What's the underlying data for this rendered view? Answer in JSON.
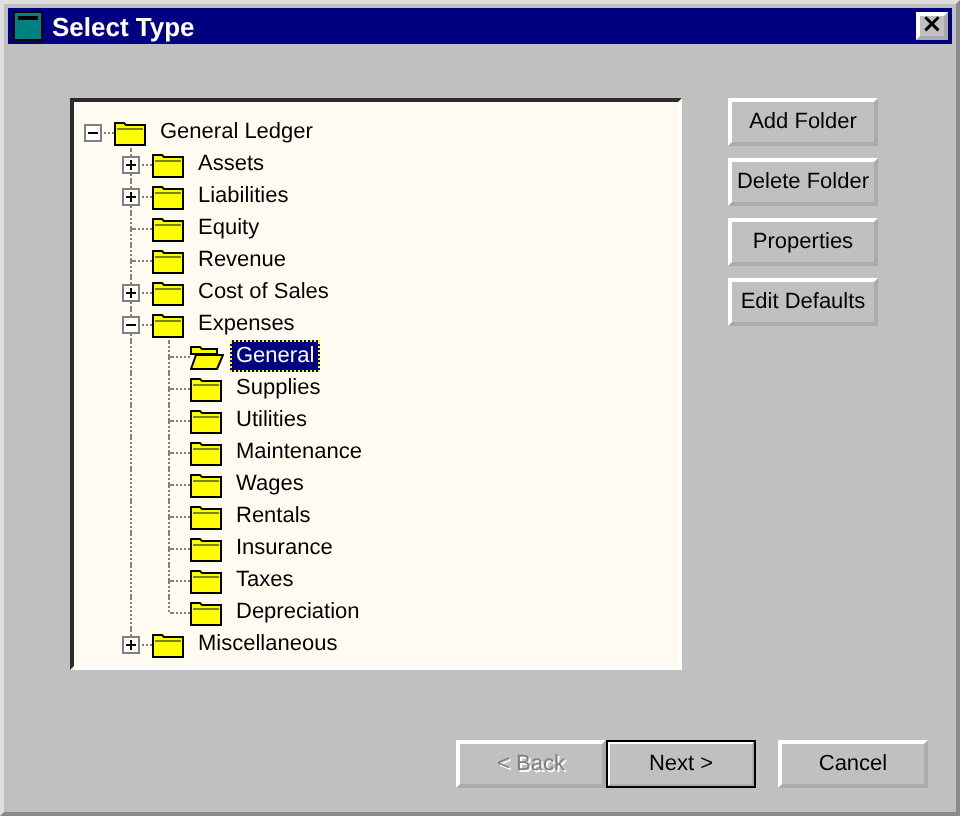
{
  "window": {
    "title": "Select Type",
    "close": "×"
  },
  "tree": [
    {
      "label": "General Ledger",
      "expanded": true,
      "selected": false,
      "children": [
        {
          "label": "Assets",
          "expanded": false,
          "selected": false
        },
        {
          "label": "Liabilities",
          "expanded": false,
          "selected": false
        },
        {
          "label": "Equity",
          "selected": false
        },
        {
          "label": "Revenue",
          "selected": false
        },
        {
          "label": "Cost of Sales",
          "expanded": false,
          "selected": false
        },
        {
          "label": "Expenses",
          "expanded": true,
          "selected": false,
          "children": [
            {
              "label": "General",
              "selected": true
            },
            {
              "label": "Supplies",
              "selected": false
            },
            {
              "label": "Utilities",
              "selected": false
            },
            {
              "label": "Maintenance",
              "selected": false
            },
            {
              "label": "Wages",
              "selected": false
            },
            {
              "label": "Rentals",
              "selected": false
            },
            {
              "label": "Insurance",
              "selected": false
            },
            {
              "label": "Taxes",
              "selected": false
            },
            {
              "label": "Depreciation",
              "selected": false
            }
          ]
        },
        {
          "label": "Miscellaneous",
          "expanded": false,
          "selected": false
        }
      ]
    }
  ],
  "side_buttons": [
    {
      "label": "Add Folder"
    },
    {
      "label": "Delete Folder"
    },
    {
      "label": "Properties"
    },
    {
      "label": "Edit Defaults"
    }
  ],
  "footer_buttons": [
    {
      "label": "< Back",
      "disabled": true,
      "default": false
    },
    {
      "label": "Next >",
      "disabled": false,
      "default": true
    },
    {
      "label": "Cancel",
      "disabled": false,
      "default": false
    }
  ]
}
